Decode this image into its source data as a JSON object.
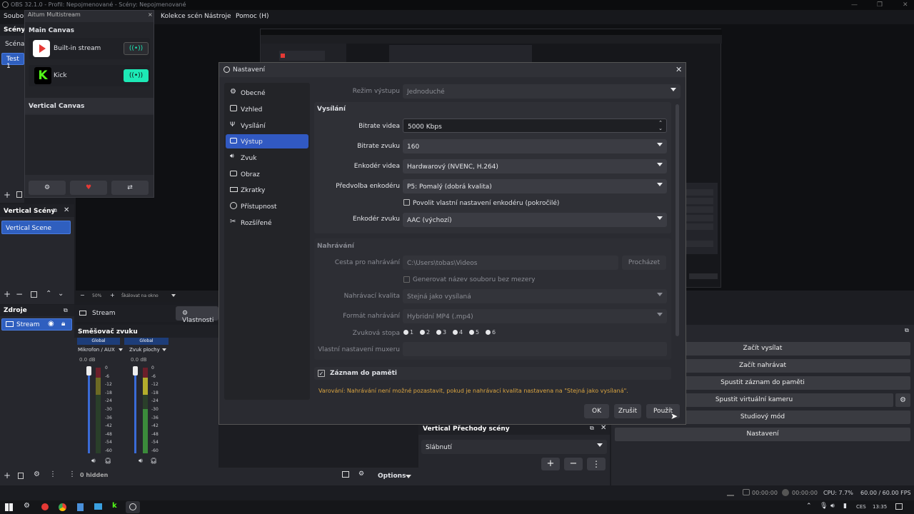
{
  "window": {
    "title": "OBS 32.1.0 - Profil: Nepojmenované - Scény: Nepojmenované"
  },
  "menu": [
    "Soubor",
    "Kolekce scén",
    "Nástroje",
    "Pomoc (H)"
  ],
  "scenes": {
    "title": "Scény",
    "items": [
      "Scéna",
      "Test 1"
    ]
  },
  "multistream": {
    "title": "Aitum Multistream",
    "main_canvas": "Main Canvas",
    "vertical_canvas": "Vertical Canvas",
    "outputs": [
      {
        "name": "Built-in stream"
      },
      {
        "name": "Kick"
      }
    ]
  },
  "vertical_scenes": {
    "title": "Vertical Scény",
    "items": [
      "Vertical Scene"
    ]
  },
  "sources": {
    "title": "Zdroje",
    "items": [
      "Stream"
    ]
  },
  "toolbar": {
    "source_name": "Stream",
    "properties": "Vlastnosti"
  },
  "preview_zoom": {
    "value": "50%",
    "mode": "Škálovat na okno"
  },
  "mixer": {
    "title": "Směšovač zvuku",
    "channels": [
      {
        "scope": "Global",
        "name": "Mikrofon / AUX",
        "db": "0.0 dB"
      },
      {
        "scope": "Global",
        "name": "Zvuk plochy",
        "db": "0.0 dB"
      }
    ],
    "ticks": [
      "0",
      "-6",
      "-12",
      "-18",
      "-24",
      "-30",
      "-36",
      "-42",
      "-48",
      "-54",
      "-60"
    ],
    "hidden": "0 hidden",
    "options": "Options"
  },
  "transitions": {
    "title": "Vertical Přechody scény",
    "value": "Slábnutí"
  },
  "controls": {
    "buttons": [
      "Začít vysílat",
      "Začít nahrávat",
      "Spustit záznam do paměti",
      "Spustit virtuální kameru",
      "Studiový mód",
      "Nastavení"
    ]
  },
  "status": {
    "time1": "00:00:00",
    "time2": "00:00:00",
    "cpu": "CPU: 7.7%",
    "fps": "60.00 / 60.00 FPS"
  },
  "taskbar": {
    "lang": "CES",
    "clock": "13:35"
  },
  "settings": {
    "title": "Nastavení",
    "nav": [
      "Obecné",
      "Vzhled",
      "Vysílání",
      "Výstup",
      "Zvuk",
      "Obraz",
      "Zkratky",
      "Přístupnost",
      "Rozšířené"
    ],
    "output_mode": {
      "label": "Režim výstupu",
      "value": "Jednoduché"
    },
    "streaming": {
      "title": "Vysílání",
      "video_bitrate": {
        "label": "Bitrate videa",
        "value": "5000 Kbps"
      },
      "audio_bitrate": {
        "label": "Bitrate zvuku",
        "value": "160"
      },
      "video_encoder": {
        "label": "Enkodér videa",
        "value": "Hardwarový (NVENC, H.264)"
      },
      "encoder_preset": {
        "label": "Předvolba enkodéru",
        "value": "P5: Pomalý (dobrá kvalita)"
      },
      "custom_encoder": "Povolit vlastní nastavení enkodéru (pokročilé)",
      "audio_encoder": {
        "label": "Enkodér zvuku",
        "value": "AAC (výchozí)"
      }
    },
    "recording": {
      "title": "Nahrávání",
      "path": {
        "label": "Cesta pro nahrávání",
        "value": "C:\\Users\\tobas\\Videos",
        "browse": "Procházet"
      },
      "no_space": "Generovat název souboru bez mezery",
      "quality": {
        "label": "Nahrávací kvalita",
        "value": "Stejná jako vysílaná"
      },
      "format": {
        "label": "Formát nahrávání",
        "value": "Hybridní MP4 (.mp4)"
      },
      "tracks": {
        "label": "Zvuková stopa",
        "items": [
          "1",
          "2",
          "3",
          "4",
          "5",
          "6"
        ]
      },
      "muxer": {
        "label": "Vlastní nastavení muxeru",
        "value": ""
      }
    },
    "replay_buffer": "Záznam do paměti",
    "warning": "Varování: Nahrávání není možné pozastavit, pokud je nahrávací kvalita nastavena na \"Stejná jako vysílaná\".",
    "buttons": {
      "ok": "OK",
      "cancel": "Zrušit",
      "apply": "Použít"
    }
  },
  "colors": {
    "accent": "#3159c2",
    "warning": "#d9a441",
    "kick": "#53fc18",
    "stream_red": "#e53935"
  }
}
